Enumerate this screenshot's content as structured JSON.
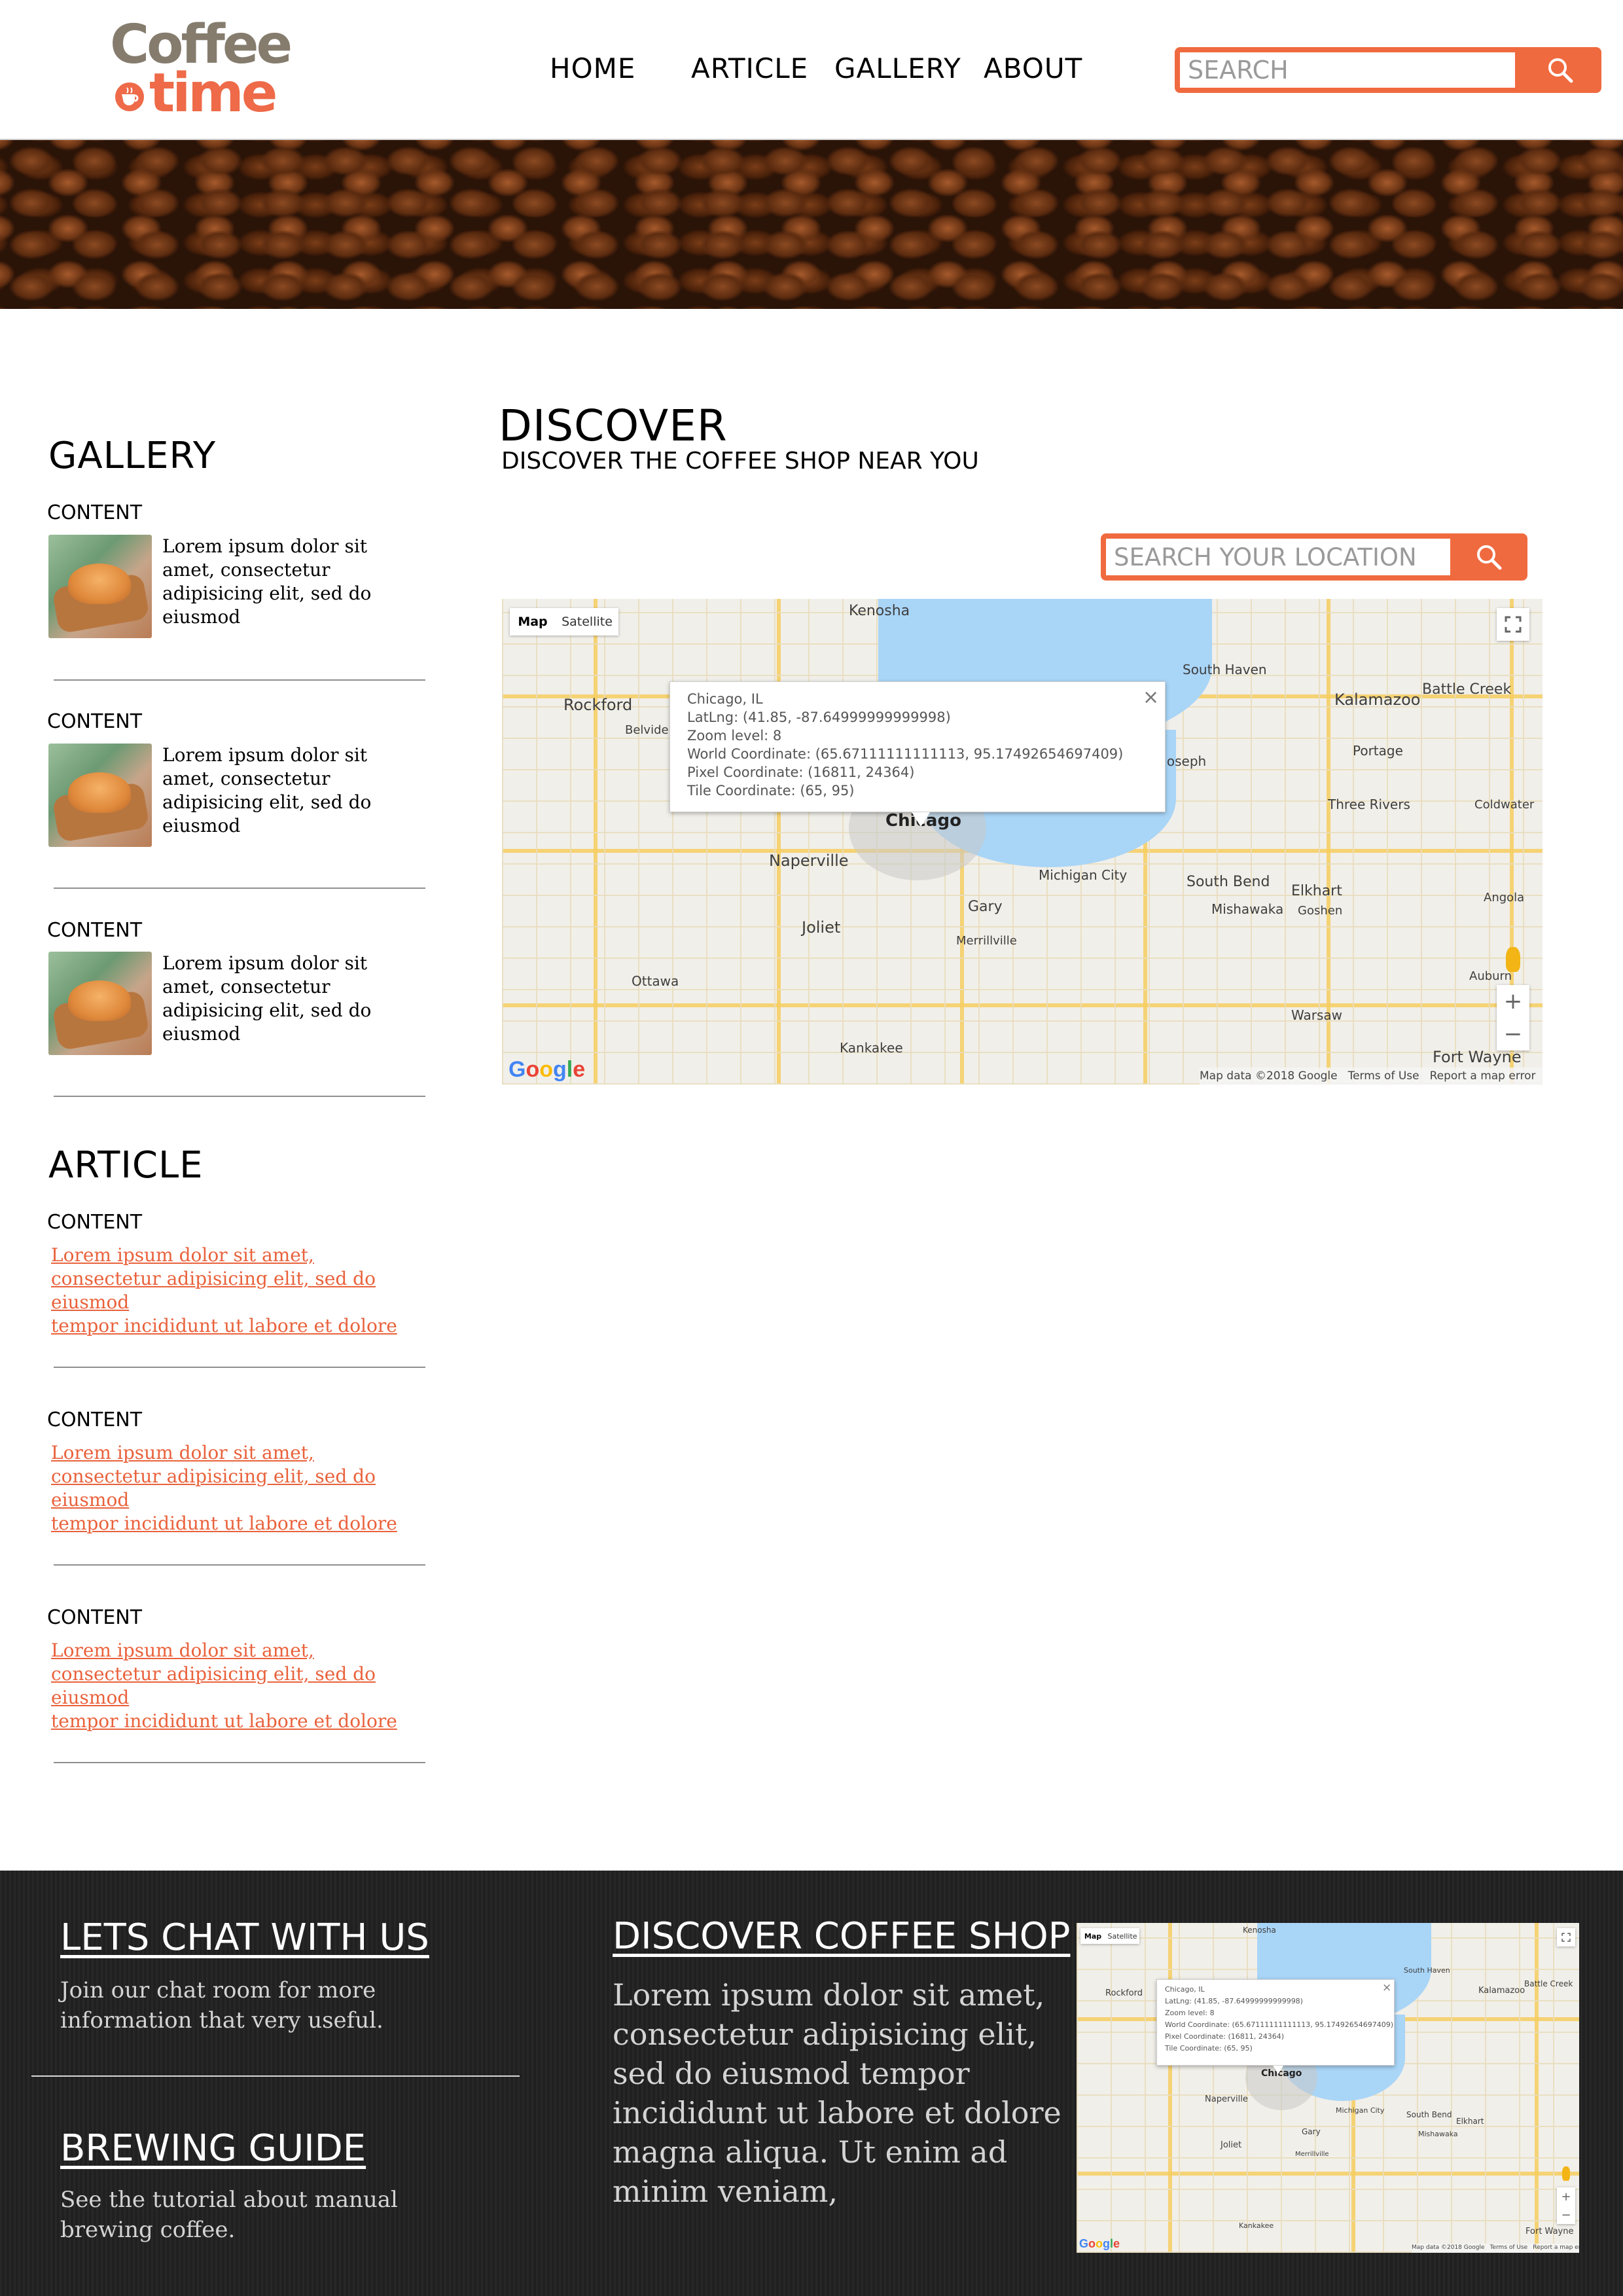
{
  "brand": {
    "line1": "Coffee",
    "line2": "time"
  },
  "nav": {
    "home": "HOME",
    "article": "ARTICLE",
    "gallery": "GALLERY",
    "about": "ABOUT"
  },
  "header_search": {
    "placeholder": "SEARCH"
  },
  "sidebar": {
    "gallery_title": "GALLERY",
    "gallery_items": [
      {
        "label": "CONTENT",
        "text": "Lorem ipsum dolor sit amet, consectetur adipisicing  elit, sed do eiusmod"
      },
      {
        "label": "CONTENT",
        "text": "Lorem ipsum dolor sit amet, consectetur adipisicing  elit, sed do eiusmod"
      },
      {
        "label": "CONTENT",
        "text": "Lorem ipsum dolor sit amet, consectetur adipisicing  elit, sed do eiusmod"
      }
    ],
    "article_title": "ARTICLE",
    "article_items": [
      {
        "label": "CONTENT",
        "line1": "Lorem ipsum dolor sit amet,",
        "line2": "consectetur adipisicing  elit, sed do",
        "line3": "eiusmod",
        "line4": "tempor incididunt ut labore et dolore"
      },
      {
        "label": "CONTENT",
        "line1": "Lorem ipsum dolor sit amet,",
        "line2": "consectetur adipisicing  elit, sed do",
        "line3": "eiusmod",
        "line4": "tempor incididunt ut labore et dolore"
      },
      {
        "label": "CONTENT",
        "line1": "Lorem ipsum dolor sit amet,",
        "line2": "consectetur adipisicing  elit, sed do",
        "line3": "eiusmod",
        "line4": "tempor incididunt ut labore et dolore"
      }
    ]
  },
  "discover": {
    "title": "DISCOVER",
    "subtitle": "DISCOVER THE COFFEE SHOP NEAR YOU",
    "search_placeholder": "SEARCH YOUR LOCATION"
  },
  "map": {
    "type_map": "Map",
    "type_satellite": "Satellite",
    "popup": {
      "line1": "Chicago, IL",
      "line2": "LatLng: (41.85, -87.64999999999998)",
      "line3": "Zoom level: 8",
      "line4": "World Coordinate: (65.67111111111113, 95.17492654697409)",
      "line5": "Pixel Coordinate: (16811, 24364)",
      "line6": "Tile Coordinate: (65, 95)",
      "close": "×"
    },
    "cities": {
      "kenosha": "Kenosha",
      "rockford": "Rockford",
      "belvidere": "Belvider",
      "south_haven": "South Haven",
      "kalamazoo": "Kalamazoo",
      "battle_creek": "Battle Creek",
      "portage": "Portage",
      "joseph": "Joseph",
      "three_rivers": "Three Rivers",
      "coldwater": "Coldwater",
      "chicago": "Chicago",
      "naperville": "Naperville",
      "michigan_city": "Michigan City",
      "south_bend": "South Bend",
      "elkhart": "Elkhart",
      "mishawaka": "Mishawaka",
      "goshen": "Goshen",
      "joliet": "Joliet",
      "gary": "Gary",
      "merrillville": "Merrillville",
      "angola": "Angola",
      "auburn": "Auburn",
      "ottawa": "Ottawa",
      "warsaw": "Warsaw",
      "kankakee": "Kankakee",
      "fort_wayne": "Fort Wayne"
    },
    "google": {
      "g1": "G",
      "o1": "o",
      "o2": "o",
      "g2": "g",
      "l": "l",
      "e": "e"
    },
    "attribution": {
      "data": "Map data ©2018 Google",
      "terms": "Terms of Use",
      "report": "Report a map error"
    },
    "zoom_in": "+",
    "zoom_out": "−"
  },
  "footer": {
    "chat_title": "LETS CHAT WITH US",
    "chat_text_1": "Join our chat room for more",
    "chat_text_2": "information that very useful.",
    "brew_title": "BREWING GUIDE",
    "brew_text_1": "See the tutorial about manual",
    "brew_text_2": "brewing coffee.",
    "discover_title": "DISCOVER COFFEE SHOP",
    "discover_text": [
      "Lorem ipsum dolor sit amet,",
      "consectetur adipisicing elit,",
      "sed do eiusmod tempor",
      "incididunt ut labore et dolore",
      "magna aliqua. Ut enim ad",
      "minim veniam,"
    ]
  },
  "colors": {
    "accent": "#f06a3f",
    "link": "#e9623c",
    "logo_brown": "#857c6e",
    "logo_orange": "#ee6a48",
    "footer_bg": "#222222",
    "map_water": "#a9d5f7"
  },
  "icons": {
    "search": "search-icon",
    "fullscreen": "fullscreen-icon",
    "pegman": "pegman-icon",
    "cup": "coffee-cup-icon"
  }
}
